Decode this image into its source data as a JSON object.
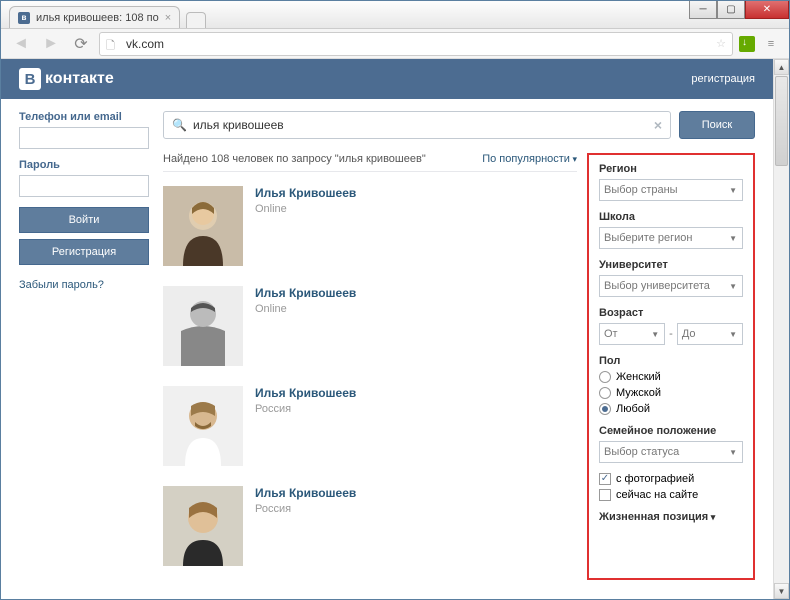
{
  "browser": {
    "tab_title": "илья кривошеев: 108 по",
    "url": "vk.com"
  },
  "vk": {
    "logo_text": "контакте",
    "reg_link": "регистрация"
  },
  "login": {
    "phone_label": "Телефон или email",
    "pass_label": "Пароль",
    "submit": "Войти",
    "register": "Регистрация",
    "forgot": "Забыли пароль?"
  },
  "search": {
    "query": "илья кривошеев",
    "button": "Поиск",
    "results_header": "Найдено 108 человек по запросу \"илья кривошеев\"",
    "sort": "По популярности"
  },
  "people": [
    {
      "name": "Илья Кривошеев",
      "status": "Online"
    },
    {
      "name": "Илья Кривошеев",
      "status": "Online"
    },
    {
      "name": "Илья Кривошеев",
      "status": "Россия"
    },
    {
      "name": "Илья Кривошеев",
      "status": "Россия"
    }
  ],
  "filters": {
    "region_label": "Регион",
    "region_select": "Выбор страны",
    "school_label": "Школа",
    "school_select": "Выберите регион",
    "uni_label": "Университет",
    "uni_select": "Выбор университета",
    "age_label": "Возраст",
    "age_from": "От",
    "age_to": "До",
    "sex_label": "Пол",
    "sex_female": "Женский",
    "sex_male": "Мужской",
    "sex_any": "Любой",
    "family_label": "Семейное положение",
    "family_select": "Выбор статуса",
    "with_photo": "с фотографией",
    "online_now": "сейчас на сайте",
    "life_pos": "Жизненная позиция"
  }
}
